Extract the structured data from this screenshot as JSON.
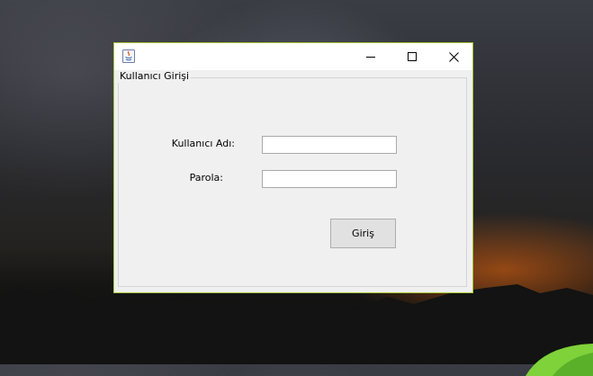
{
  "window": {
    "title": "",
    "icons": {
      "app": "java-app-icon",
      "minimize": "minimize-icon",
      "maximize": "maximize-icon",
      "close": "close-icon"
    }
  },
  "form": {
    "group_title": "Kullanıcı Girişi",
    "username_label": "Kullanıcı Adı:",
    "username_value": "",
    "password_label": "Parola:",
    "password_value": "",
    "login_button": "Giriş"
  },
  "colors": {
    "window_border": "#a8c83a",
    "window_bg": "#f0f0f0",
    "button_bg": "#e1e1e1"
  }
}
